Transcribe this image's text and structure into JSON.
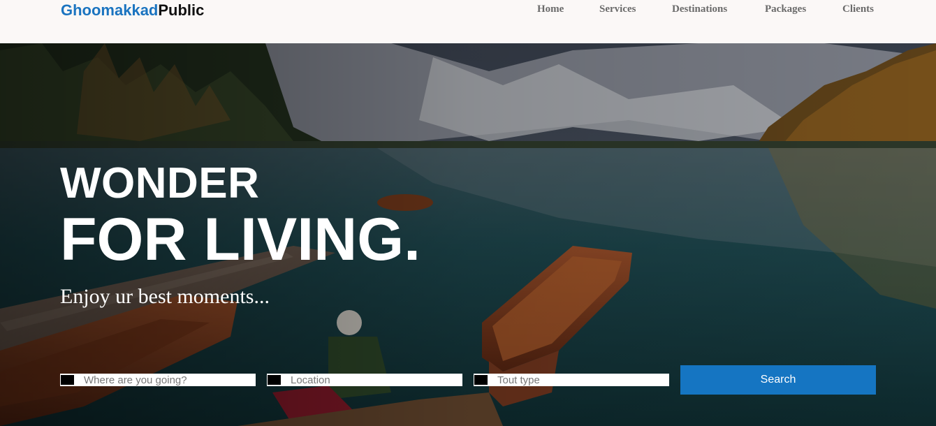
{
  "brand": {
    "part1": "Ghoomakkad",
    "part2": "Public"
  },
  "nav": {
    "items": [
      "Home",
      "Services",
      "Destinations",
      "Packages",
      "Clients"
    ]
  },
  "hero": {
    "line1": "WONDER",
    "line2": "FOR LIVING.",
    "tagline": "Enjoy ur best moments..."
  },
  "search": {
    "destination_placeholder": "Where are you going?",
    "location_placeholder": "Location",
    "tour_placeholder": "Tout type",
    "button_label": "Search"
  },
  "colors": {
    "brand_blue": "#1b74c0",
    "button_blue": "#1575c2",
    "nav_bg": "#fbf8f7"
  }
}
